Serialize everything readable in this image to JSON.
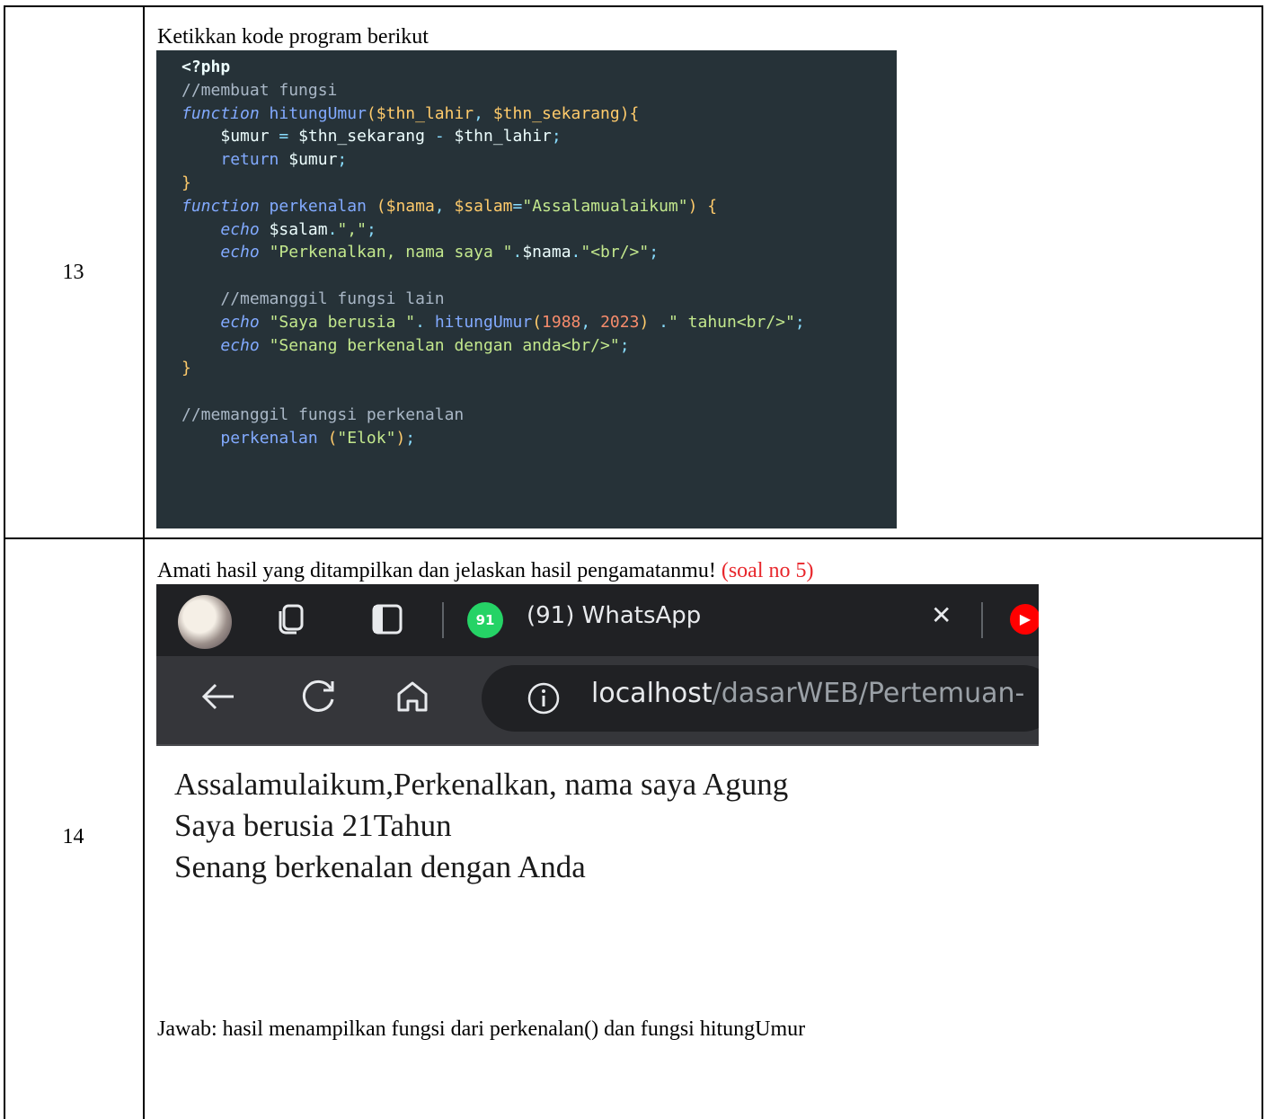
{
  "rows": [
    {
      "number": "13",
      "instruction": "Ketikkan kode program berikut"
    },
    {
      "number": "14",
      "instruction": "Amati hasil yang ditampilkan dan jelaskan hasil pengamatanmu!",
      "note": "(soal no 5)",
      "answer": "Jawab: hasil menampilkan fungsi dari perkenalan() dan fungsi hitungUmur"
    }
  ],
  "code": {
    "open_tag": "<?php",
    "comment1": "//membuat fungsi",
    "kw_function": "function",
    "fn_hitung": "hitungUmur",
    "param_lahir": "$thn_lahir",
    "param_sekarang": "$thn_sekarang",
    "var_umur": "$umur",
    "kw_return": "return",
    "fn_perkenalan": "perkenalan",
    "param_nama": "$nama",
    "param_salam": "$salam",
    "str_salam_default": "\"Assalamualaikum\"",
    "kw_echo": "echo",
    "str_comma": "\",\"",
    "str_perkenalkan": "\"Perkenalkan, nama saya \"",
    "str_br": "\"<br/>\"",
    "comment2": "//memanggil fungsi lain",
    "str_berusia": "\"Saya berusia \"",
    "num_1988": "1988",
    "num_2023": "2023",
    "str_tahun": "\" tahun<br/>\"",
    "str_senang": "\"Senang berkenalan dengan anda<br/>\"",
    "comment3": "//memanggil fungsi perkenalan",
    "str_elok": "\"Elok\"",
    "close_tag": "?>"
  },
  "browser": {
    "tab_badge": "91",
    "tab_title": "(91) WhatsApp",
    "url_host": "localhost",
    "url_path": "/dasarWEB/Pertemuan-",
    "icons": [
      "avatar",
      "collections-icon",
      "tab-icon",
      "whatsapp-icon",
      "close-icon",
      "youtube-icon",
      "back-icon",
      "refresh-icon",
      "home-icon",
      "info-icon"
    ]
  },
  "output": {
    "line1": "Assalamulaikum,Perkenalkan, nama saya Agung",
    "line2": "Saya berusia 21Tahun",
    "line3": "Senang berkenalan dengan Anda"
  },
  "colors": {
    "code_bg": "#263238",
    "note_red": "#e8262b",
    "tab_bg": "#202124",
    "address_bg": "#35363a"
  }
}
